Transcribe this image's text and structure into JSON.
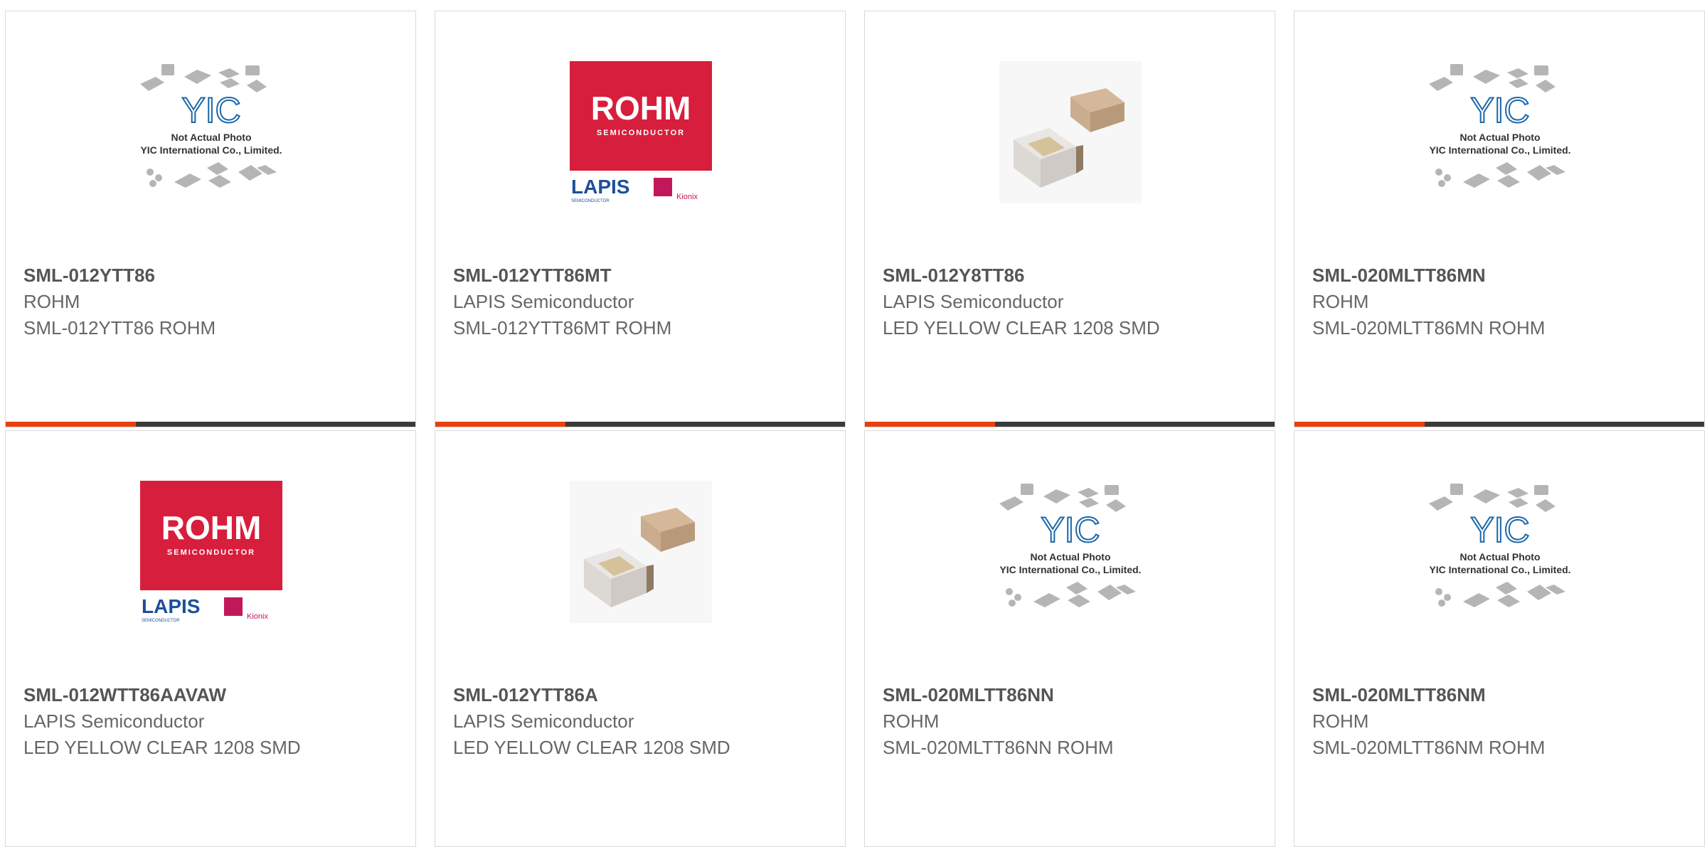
{
  "products": [
    {
      "part": "SML-012YTT86",
      "manufacturer": "ROHM",
      "description": "SML-012YTT86 ROHM",
      "image": "placeholder-photo"
    },
    {
      "part": "SML-012YTT86MT",
      "manufacturer": "LAPIS Semiconductor",
      "description": "SML-012YTT86MT ROHM",
      "image": "rohm-logo"
    },
    {
      "part": "SML-012Y8TT86",
      "manufacturer": "LAPIS Semiconductor",
      "description": "LED YELLOW CLEAR 1208 SMD",
      "image": "led-photo"
    },
    {
      "part": "SML-020MLTT86MN",
      "manufacturer": "ROHM",
      "description": "SML-020MLTT86MN ROHM",
      "image": "placeholder-photo"
    },
    {
      "part": "SML-012WTT86AAVAW",
      "manufacturer": "LAPIS Semiconductor",
      "description": "LED YELLOW CLEAR 1208 SMD",
      "image": "rohm-logo"
    },
    {
      "part": "SML-012YTT86A",
      "manufacturer": "LAPIS Semiconductor",
      "description": "LED YELLOW CLEAR 1208 SMD",
      "image": "led-photo"
    },
    {
      "part": "SML-020MLTT86NN",
      "manufacturer": "ROHM",
      "description": "SML-020MLTT86NN ROHM",
      "image": "placeholder-photo"
    },
    {
      "part": "SML-020MLTT86NM",
      "manufacturer": "ROHM",
      "description": "SML-020MLTT86NM ROHM",
      "image": "placeholder-photo"
    }
  ],
  "placeholder": {
    "line1": "Not Actual Photo",
    "line2": "YIC International Co., Limited.",
    "logo": "YIC"
  },
  "rohm_logo": {
    "brand": "ROHM",
    "sub": "SEMICONDUCTOR",
    "lapis": "LAPIS",
    "lapis_sub": "SEMICONDUCTOR",
    "kionix": "Kionix"
  },
  "colors": {
    "accent": "#e8400f",
    "bar": "#3a3a3a",
    "rohm_red": "#d71e3c",
    "lapis_blue": "#1d4f9c",
    "kionix_pink": "#c2185b"
  }
}
